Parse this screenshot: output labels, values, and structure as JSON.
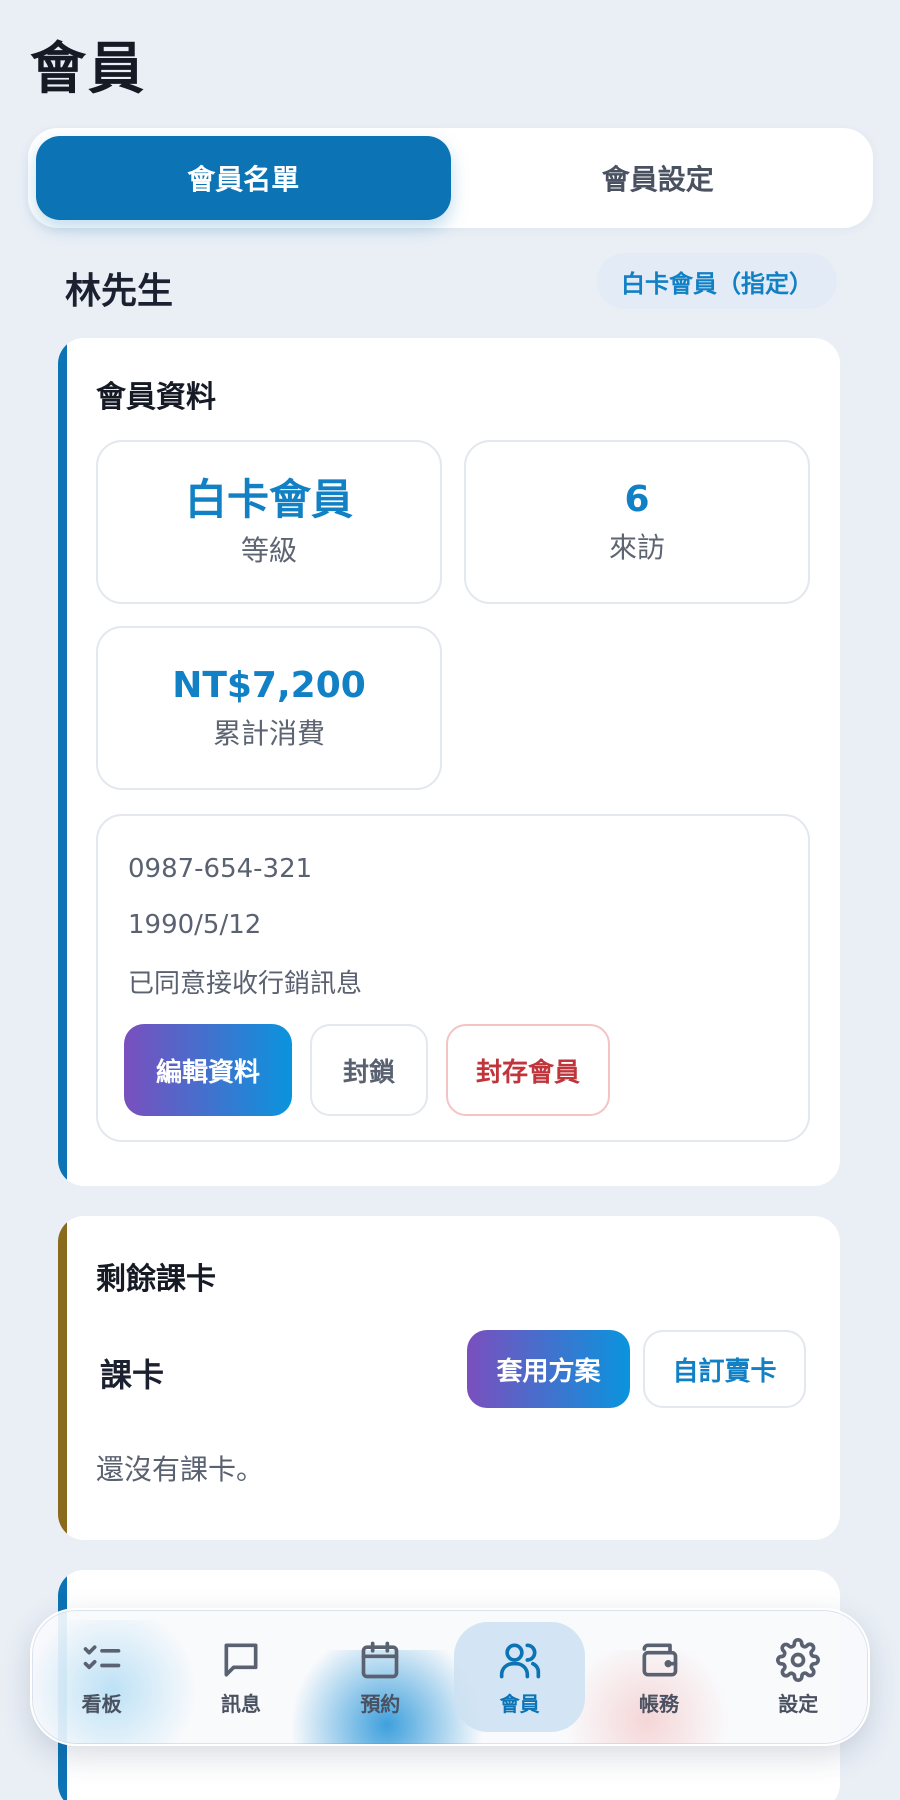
{
  "page": {
    "title": "會員"
  },
  "tabs": [
    {
      "label": "會員名單",
      "active": true
    },
    {
      "label": "會員設定",
      "active": false
    }
  ],
  "member": {
    "name": "林先生",
    "badge": "白卡會員（指定）"
  },
  "profile": {
    "title": "會員資料",
    "stats": [
      {
        "value": "白卡會員",
        "label": "等級"
      },
      {
        "value": "6",
        "label": "來訪"
      },
      {
        "value": "NT$7,200",
        "label": "累計消費"
      }
    ],
    "phone": "0987-654-321",
    "birthday": "1990/5/12",
    "marketing": "已同意接收行銷訊息",
    "actions": {
      "edit": "編輯資料",
      "block": "封鎖",
      "archive": "封存會員"
    }
  },
  "cards": {
    "title": "剩餘課卡",
    "subtitle": "課卡",
    "apply_plan": "套用方案",
    "custom_sell": "自訂賣卡",
    "empty": "還沒有課卡。"
  },
  "nav": [
    {
      "label": "看板",
      "icon": "checklist-icon",
      "active": false
    },
    {
      "label": "訊息",
      "icon": "chat-bubble-icon",
      "active": false
    },
    {
      "label": "預約",
      "icon": "calendar-icon",
      "active": false
    },
    {
      "label": "會員",
      "icon": "users-icon",
      "active": true
    },
    {
      "label": "帳務",
      "icon": "wallet-icon",
      "active": false
    },
    {
      "label": "設定",
      "icon": "gear-icon",
      "active": false
    }
  ],
  "colors": {
    "accent": "#0c73b4",
    "accent_text": "#1180c4",
    "danger": "#c0353b",
    "gold": "#8a6a1c",
    "background": "#eaeff6"
  }
}
